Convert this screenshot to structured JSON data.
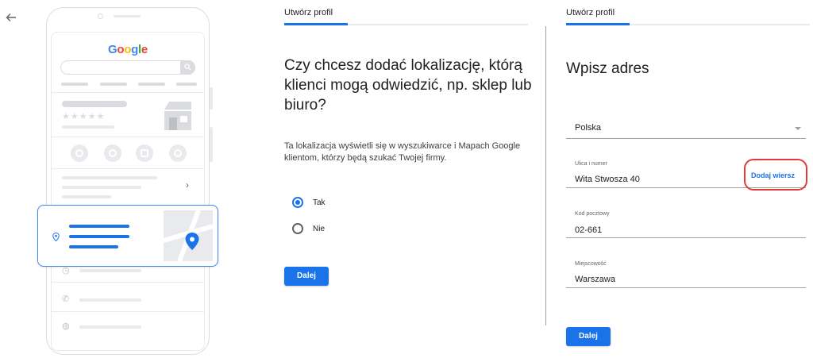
{
  "nav": {
    "back_icon": "arrow-left-icon"
  },
  "illustration": {
    "logo_letters": [
      "G",
      "o",
      "o",
      "g",
      "l",
      "e"
    ],
    "stars": "★★★★★",
    "chevron": "›"
  },
  "left_panel": {
    "title": "Utwórz profil",
    "question": "Czy chcesz dodać lokalizację, którą klienci mogą odwiedzić, np. sklep lub biuro?",
    "description": "Ta lokalizacja wyświetli się w wyszukiwarce i Mapach Google klientom, którzy będą szukać Twojej firmy.",
    "options": [
      {
        "label": "Tak",
        "selected": true
      },
      {
        "label": "Nie",
        "selected": false
      }
    ],
    "next_label": "Dalej"
  },
  "right_panel": {
    "title": "Utwórz profil",
    "heading": "Wpisz adres",
    "country": {
      "value": "Polska"
    },
    "street": {
      "label": "Ulica i numer",
      "value": "Wita Stwosza 40",
      "add_row_label": "Dodaj wiersz"
    },
    "postal": {
      "label": "Kod pocztowy",
      "value": "02-661"
    },
    "city": {
      "label": "Miejscowość",
      "value": "Warszawa"
    },
    "next_label": "Dalej"
  },
  "colors": {
    "accent": "#1a73e8",
    "annotation": "#e53935"
  }
}
